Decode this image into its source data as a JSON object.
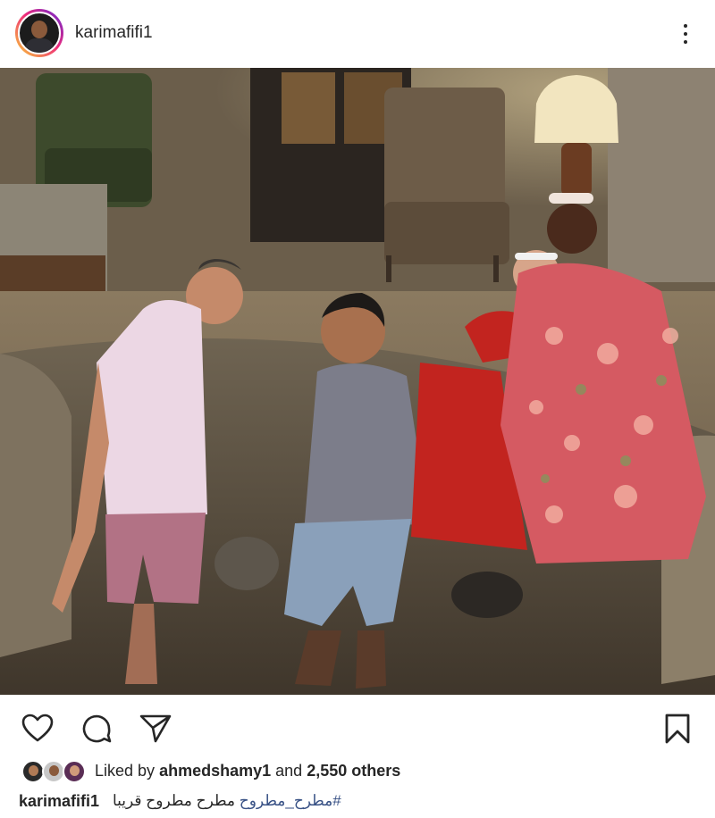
{
  "post": {
    "username": "karimafifi1",
    "avatar_icon": "profile-avatar",
    "more_icon": "more-vertical-icon"
  },
  "photo": {
    "description_icon": "post-photo"
  },
  "actions": {
    "like_icon": "heart-icon",
    "comment_icon": "comment-icon",
    "share_icon": "send-icon",
    "save_icon": "bookmark-icon"
  },
  "likes": {
    "prefix": "Liked by",
    "liker": "ahmedshamy1",
    "joiner": "and",
    "others": "2,550 others"
  },
  "caption": {
    "username": "karimafifi1",
    "hashtag": "#مطرح_مطروح",
    "text": "مطرح مطروح قريبا"
  },
  "colors": {
    "text": "#262626",
    "hashtag": "#385185",
    "story_ring": "#ee2a7b"
  }
}
